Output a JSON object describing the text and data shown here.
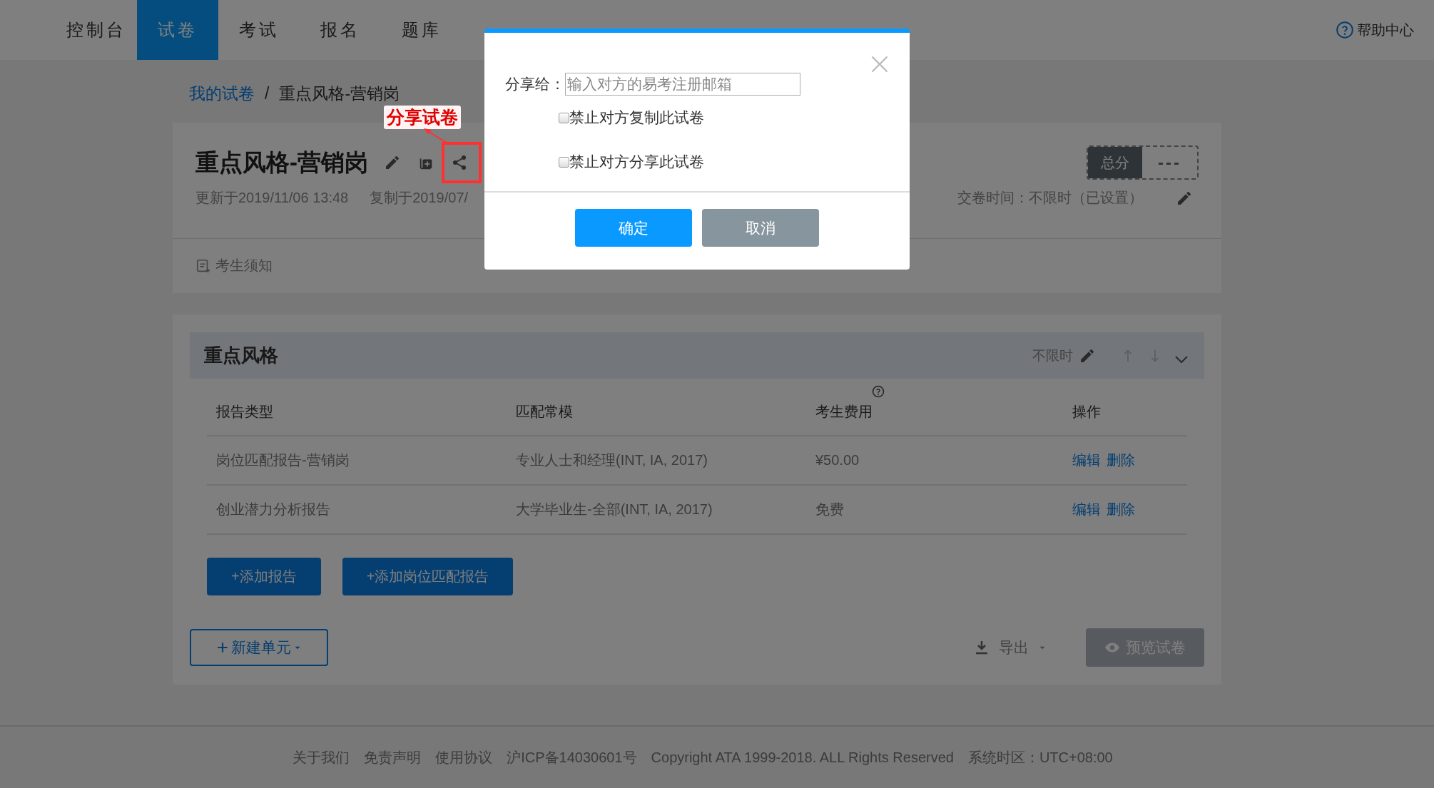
{
  "nav": {
    "tabs": [
      {
        "label": "控制台",
        "selected": false
      },
      {
        "label": "试卷",
        "selected": true
      },
      {
        "label": "考试",
        "selected": false
      },
      {
        "label": "报名",
        "selected": false
      },
      {
        "label": "题库",
        "selected": false
      }
    ],
    "help": "帮助中心"
  },
  "breadcrumb": {
    "parent": "我的试卷",
    "separator": "/",
    "current": "重点风格-营销岗"
  },
  "paper": {
    "title": "重点风格-营销岗",
    "updated": "更新于2019/11/06 13:48",
    "copied": "复制于2019/07/",
    "total_label": "总分",
    "total_value": "---",
    "deadline": "交卷时间：不限时（已设置）",
    "notice": "考生须知"
  },
  "annotation": {
    "text": "分享试卷"
  },
  "section": {
    "title": "重点风格",
    "time": "不限时",
    "columns": [
      "报告类型",
      "匹配常模",
      "考生费用",
      "操作"
    ],
    "rows": [
      {
        "cells": [
          "岗位匹配报告-营销岗",
          "专业人士和经理(INT, IA, 2017)",
          "¥50.00"
        ],
        "actions": [
          "编辑",
          "删除"
        ]
      },
      {
        "cells": [
          "创业潜力分析报告",
          "大学毕业生-全部(INT, IA, 2017)",
          "免费"
        ],
        "actions": [
          "编辑",
          "删除"
        ]
      }
    ],
    "add_buttons": [
      "+添加报告",
      "+添加岗位匹配报告"
    ]
  },
  "toolbar": {
    "new_unit": "新建单元",
    "export": "导出",
    "preview": "预览试卷"
  },
  "footer": {
    "links": [
      "关于我们",
      "免责声明",
      "使用协议"
    ],
    "icp": "沪ICP备14030601号",
    "copyright": "Copyright ATA 1999-2018. ALL Rights Reserved",
    "timezone": "系统时区：UTC+08:00"
  },
  "modal": {
    "label": "分享给：",
    "placeholder": "输入对方的易考注册邮箱",
    "options": [
      {
        "label": "禁止对方复制此试卷",
        "checked": false
      },
      {
        "label": "禁止对方分享此试卷",
        "checked": false
      }
    ],
    "confirm": "确定",
    "cancel": "取消"
  }
}
